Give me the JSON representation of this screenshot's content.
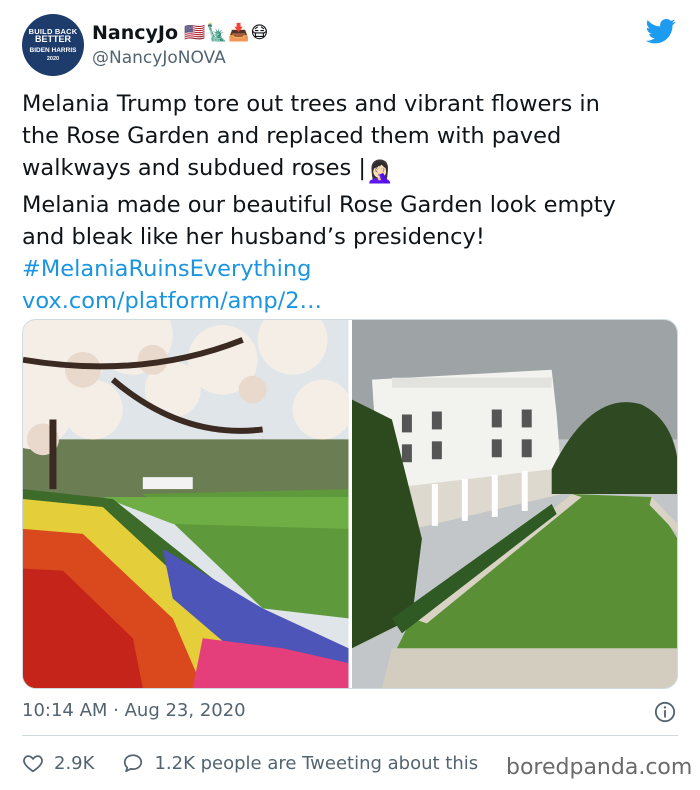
{
  "author": {
    "display_name": "NancyJo",
    "handle": "@NancyJoNOVA",
    "name_emojis": "🇺🇸🗽📥😷",
    "avatar": {
      "line1": "BUILD BACK",
      "line2": "BETTER",
      "line3": "BIDEN HARRIS",
      "line4": "2020"
    }
  },
  "tweet": {
    "line1": "Melania Trump tore out trees and vibrant flowers in",
    "line2": "the Rose Garden and replaced them with paved",
    "line3": "walkways and subdued roses |",
    "line3_emoji": "🤦🏻‍♀️",
    "line4": "Melania made our beautiful Rose Garden look empty",
    "line5": "and bleak like her husband’s presidency!",
    "hashtag": "#MelaniaRuinsEverything",
    "link": "vox.com/platform/amp/2…"
  },
  "timestamp": "10:14 AM · Aug 23, 2020",
  "stats": {
    "likes": "2.9K",
    "tweeting": "1.2K people are Tweeting about this"
  },
  "watermark": "boredpanda.com",
  "icons": {
    "brand": "twitter-bird-icon",
    "like": "heart-icon",
    "reply": "speech-bubble-icon",
    "info": "info-icon"
  },
  "colors": {
    "link": "#1b95e0",
    "secondary_text": "#536471",
    "twitter_blue": "#1d9bf0"
  }
}
